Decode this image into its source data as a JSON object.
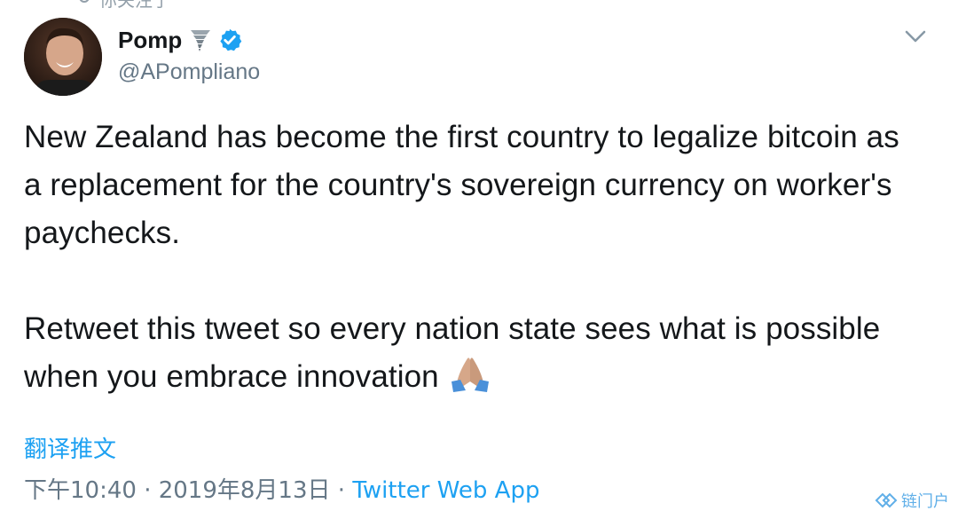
{
  "context": {
    "label": "你关注了"
  },
  "tweet": {
    "author": {
      "display_name": "Pomp",
      "handle": "@APompliano",
      "verified": true
    },
    "text_para1": "New Zealand has become the first country to legalize bitcoin as a replacement for the country's sovereign currency on worker's paychecks.",
    "text_para2": "Retweet this tweet so every nation state sees what is possible when you embrace innovation",
    "translate_label": "翻译推文",
    "timestamp": "下午10:40 · 2019年8月13日",
    "separator": " · ",
    "source": "Twitter Web App"
  },
  "icons": {
    "menu": "chevron-down-icon",
    "verified": "verified-badge-icon",
    "tornado": "tornado-emoji-icon",
    "pray": "folded-hands-emoji-icon"
  },
  "colors": {
    "link": "#1da1f2",
    "secondary_text": "#657786",
    "primary_text": "#14171a"
  },
  "watermark": {
    "label": "链门户"
  }
}
